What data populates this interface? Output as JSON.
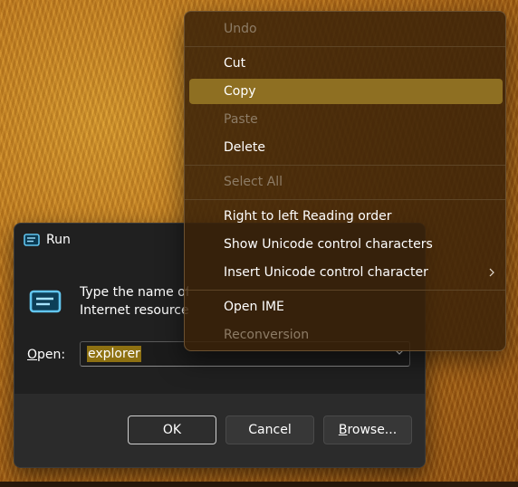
{
  "run_dialog": {
    "title": "Run",
    "description": "Type the name of\nInternet resource,",
    "open_label_accel": "O",
    "open_label_rest": "pen:",
    "open_value": "explorer",
    "buttons": {
      "ok": "OK",
      "cancel": "Cancel",
      "browse_accel": "B",
      "browse_rest": "rowse..."
    }
  },
  "context_menu": {
    "items": [
      {
        "label": "Undo",
        "enabled": false
      },
      {
        "label": "Cut",
        "enabled": true
      },
      {
        "label": "Copy",
        "enabled": true,
        "highlighted": true
      },
      {
        "label": "Paste",
        "enabled": false
      },
      {
        "label": "Delete",
        "enabled": true
      },
      {
        "label": "Select All",
        "enabled": false
      },
      {
        "label": "Right to left Reading order",
        "enabled": true
      },
      {
        "label": "Show Unicode control characters",
        "enabled": true
      },
      {
        "label": "Insert Unicode control character",
        "enabled": true,
        "submenu": true
      },
      {
        "label": "Open IME",
        "enabled": true
      },
      {
        "label": "Reconversion",
        "enabled": false
      }
    ]
  },
  "colors": {
    "highlight": "#8e6f22",
    "selection": "#8e7112",
    "dialog_bg": "#202020",
    "menu_bg": "#3a2208"
  },
  "icons": {
    "run_title": "run-window-icon",
    "run_big": "run-window-icon",
    "dropdown": "chevron-down-icon",
    "submenu": "chevron-right-icon"
  }
}
